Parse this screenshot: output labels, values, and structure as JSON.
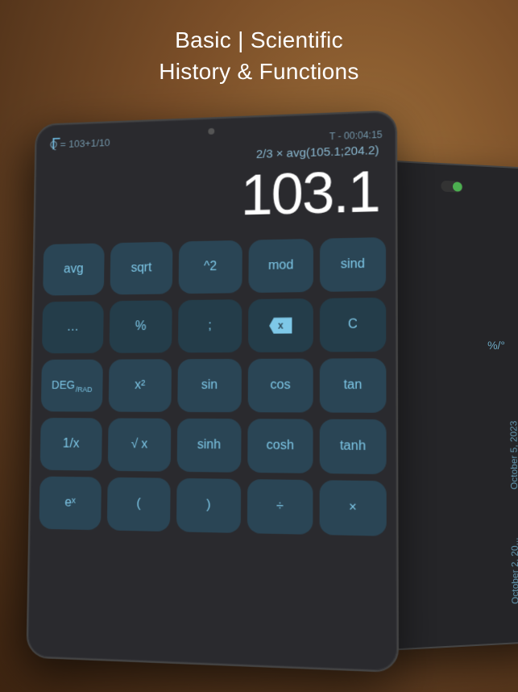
{
  "title": {
    "line1": "Basic | Scientific",
    "line2": "History & Functions"
  },
  "tablet": {
    "corner_symbol": "Γ",
    "timer": "T - 00:04:15",
    "main_expression": "2/3 × avg(105.1;204.2)",
    "history_expression": "Q = 103+1/10",
    "result": "103.1",
    "buttons": [
      [
        {
          "label": "avg",
          "style": "medium"
        },
        {
          "label": "sqrt",
          "style": "medium"
        },
        {
          "label": "^2",
          "style": "medium"
        },
        {
          "label": "mod",
          "style": "medium"
        },
        {
          "label": "sind",
          "style": "medium"
        }
      ],
      [
        {
          "label": "…",
          "style": "darker"
        },
        {
          "label": "%",
          "style": "darker"
        },
        {
          "label": ";",
          "style": "darker"
        },
        {
          "label": "⌫",
          "style": "darker",
          "special": "delete"
        },
        {
          "label": "C",
          "style": "darker"
        }
      ],
      [
        {
          "label": "DEG/RAD",
          "style": "medium",
          "special": "deg"
        },
        {
          "label": "x²",
          "style": "medium"
        },
        {
          "label": "sin",
          "style": "medium"
        },
        {
          "label": "cos",
          "style": "medium"
        },
        {
          "label": "tan",
          "style": "medium"
        }
      ],
      [
        {
          "label": "1/x",
          "style": "medium"
        },
        {
          "label": "√x",
          "style": "medium"
        },
        {
          "label": "sinh",
          "style": "medium"
        },
        {
          "label": "cosh",
          "style": "medium"
        },
        {
          "label": "tanh",
          "style": "medium"
        }
      ],
      [
        {
          "label": "eˣ",
          "style": "medium"
        },
        {
          "label": "(",
          "style": "medium"
        },
        {
          "label": ")",
          "style": "medium"
        },
        {
          "label": "÷",
          "style": "medium"
        },
        {
          "label": "×",
          "style": "medium"
        }
      ]
    ]
  },
  "second_tablet": {
    "label": "%/°",
    "history_dates": [
      "October 5, 2023",
      "October 2, 20..."
    ]
  }
}
